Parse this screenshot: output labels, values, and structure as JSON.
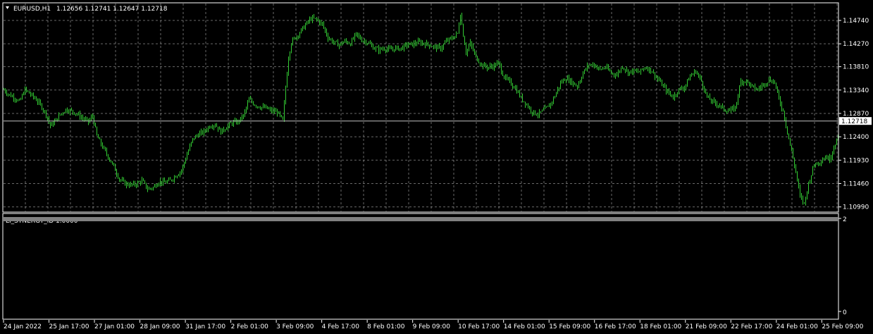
{
  "window": {
    "symbol_label": "EURUSD,H1",
    "ohlc_label": "1.12656 1.12741 1.12647 1.12718",
    "indicator_label": "LI_SYNERGY_ID 1.0000",
    "dropdown_icon": "triangle-down-icon"
  },
  "colors": {
    "background": "#000000",
    "grid": "#c0c0c0",
    "bars": "#33cc33",
    "frame": "#ffffff",
    "price_line": "#c0c0c0",
    "indicator_band": "#808080",
    "current_price_bg": "#ffffff",
    "current_price_text": "#000000"
  },
  "chart_data": [
    {
      "type": "line",
      "title": "EURUSD,H1",
      "series": [
        {
          "name": "EURUSD",
          "x": [
            0,
            7,
            14,
            22,
            30,
            38,
            46,
            54,
            60,
            66,
            72,
            80,
            88,
            96,
            104,
            112,
            120,
            126,
            132,
            140,
            148,
            156,
            164,
            172,
            180,
            188,
            196,
            204,
            212,
            220,
            228,
            236,
            244,
            252,
            260,
            268,
            276,
            284,
            292,
            300,
            308,
            316,
            324,
            332,
            340,
            348,
            356,
            364,
            372,
            380,
            388,
            396,
            400,
            404,
            408,
            414,
            420,
            428,
            436,
            444,
            452,
            460,
            468,
            476,
            484,
            492,
            500,
            508,
            516,
            524,
            532,
            540,
            548,
            556,
            564,
            572,
            580,
            588,
            596,
            604,
            612,
            620,
            628,
            636,
            644,
            648,
            652,
            656,
            662,
            670,
            678,
            686,
            694,
            702,
            710,
            718,
            726,
            734,
            742,
            750,
            758,
            766,
            774,
            782,
            790,
            798,
            806,
            814,
            822,
            830,
            838,
            846,
            854,
            862,
            870,
            878,
            886,
            894,
            902,
            910,
            918,
            926,
            934,
            942,
            950,
            958,
            966,
            974,
            982,
            990,
            998,
            1006,
            1014,
            1022,
            1030,
            1038,
            1046,
            1054,
            1062,
            1070,
            1078,
            1086,
            1094,
            1100,
            1106,
            1112,
            1118,
            1124,
            1130,
            1136,
            1142,
            1150,
            1158,
            1166,
            1172,
            1178,
            1184
          ],
          "close": [
            1.1335,
            1.1325,
            1.132,
            1.131,
            1.1335,
            1.1325,
            1.1315,
            1.13,
            1.1285,
            1.1262,
            1.127,
            1.1285,
            1.1295,
            1.1292,
            1.1286,
            1.1277,
            1.127,
            1.1282,
            1.1242,
            1.122,
            1.12,
            1.118,
            1.1155,
            1.1146,
            1.1143,
            1.1145,
            1.1152,
            1.1135,
            1.1138,
            1.115,
            1.1148,
            1.1152,
            1.1162,
            1.1172,
            1.1205,
            1.1235,
            1.1245,
            1.125,
            1.1262,
            1.1265,
            1.125,
            1.126,
            1.1268,
            1.127,
            1.1282,
            1.1315,
            1.1305,
            1.13,
            1.1298,
            1.1292,
            1.129,
            1.1272,
            1.134,
            1.14,
            1.143,
            1.144,
            1.145,
            1.1465,
            1.1478,
            1.1476,
            1.1466,
            1.144,
            1.143,
            1.1425,
            1.1432,
            1.1428,
            1.1446,
            1.1435,
            1.143,
            1.142,
            1.1415,
            1.1418,
            1.1415,
            1.1418,
            1.1418,
            1.1425,
            1.1426,
            1.143,
            1.1428,
            1.1425,
            1.142,
            1.1418,
            1.1432,
            1.1438,
            1.1448,
            1.1488,
            1.1445,
            1.141,
            1.1428,
            1.14,
            1.1385,
            1.138,
            1.1382,
            1.1388,
            1.136,
            1.135,
            1.1338,
            1.1318,
            1.1305,
            1.129,
            1.1285,
            1.1293,
            1.1302,
            1.1322,
            1.1348,
            1.1358,
            1.135,
            1.1342,
            1.1368,
            1.1385,
            1.1385,
            1.1375,
            1.138,
            1.1368,
            1.1365,
            1.1382,
            1.137,
            1.1372,
            1.137,
            1.138,
            1.1375,
            1.136,
            1.1345,
            1.133,
            1.132,
            1.1335,
            1.134,
            1.1362,
            1.1372,
            1.1352,
            1.132,
            1.131,
            1.1305,
            1.1295,
            1.1292,
            1.1298,
            1.1352,
            1.1352,
            1.134,
            1.1335,
            1.1345,
            1.1355,
            1.135,
            1.1315,
            1.1292,
            1.125,
            1.121,
            1.117,
            1.112,
            1.1105,
            1.1145,
            1.1185,
            1.119,
            1.12,
            1.1195,
            1.122,
            1.124,
            1.125,
            1.1265,
            1.1272
          ]
        }
      ],
      "y_ticks": [
        1.1099,
        1.1146,
        1.1193,
        1.124,
        1.1287,
        1.1334,
        1.1381,
        1.1427,
        1.1474
      ],
      "y_tick_labels": [
        "1.10990",
        "1.11460",
        "1.11930",
        "1.12400",
        "1.12870",
        "1.13340",
        "1.13810",
        "1.14270",
        "1.14740"
      ],
      "ylim": [
        1.109,
        1.1508
      ],
      "current_price": 1.12718,
      "current_price_label": "1.12718",
      "x_tick_labels": [
        "24 Jan 2022",
        "25 Jan 17:00",
        "27 Jan 01:00",
        "28 Jan 09:00",
        "31 Jan 17:00",
        "2 Feb 01:00",
        "3 Feb 09:00",
        "4 Feb 17:00",
        "8 Feb 01:00",
        "9 Feb 09:00",
        "10 Feb 17:00",
        "14 Feb 01:00",
        "15 Feb 09:00",
        "16 Feb 17:00",
        "18 Feb 01:00",
        "21 Feb 09:00",
        "22 Feb 17:00",
        "24 Feb 01:00",
        "25 Feb 09:00"
      ],
      "grid": true
    },
    {
      "type": "line",
      "title": "LI_SYNERGY_ID 1.0000",
      "series": [
        {
          "name": "LI_SYNERGY_ID",
          "value": 1.0
        }
      ],
      "y_tick_labels": [
        "2",
        "0"
      ],
      "ylim": [
        0,
        2
      ],
      "grid": false
    }
  ]
}
